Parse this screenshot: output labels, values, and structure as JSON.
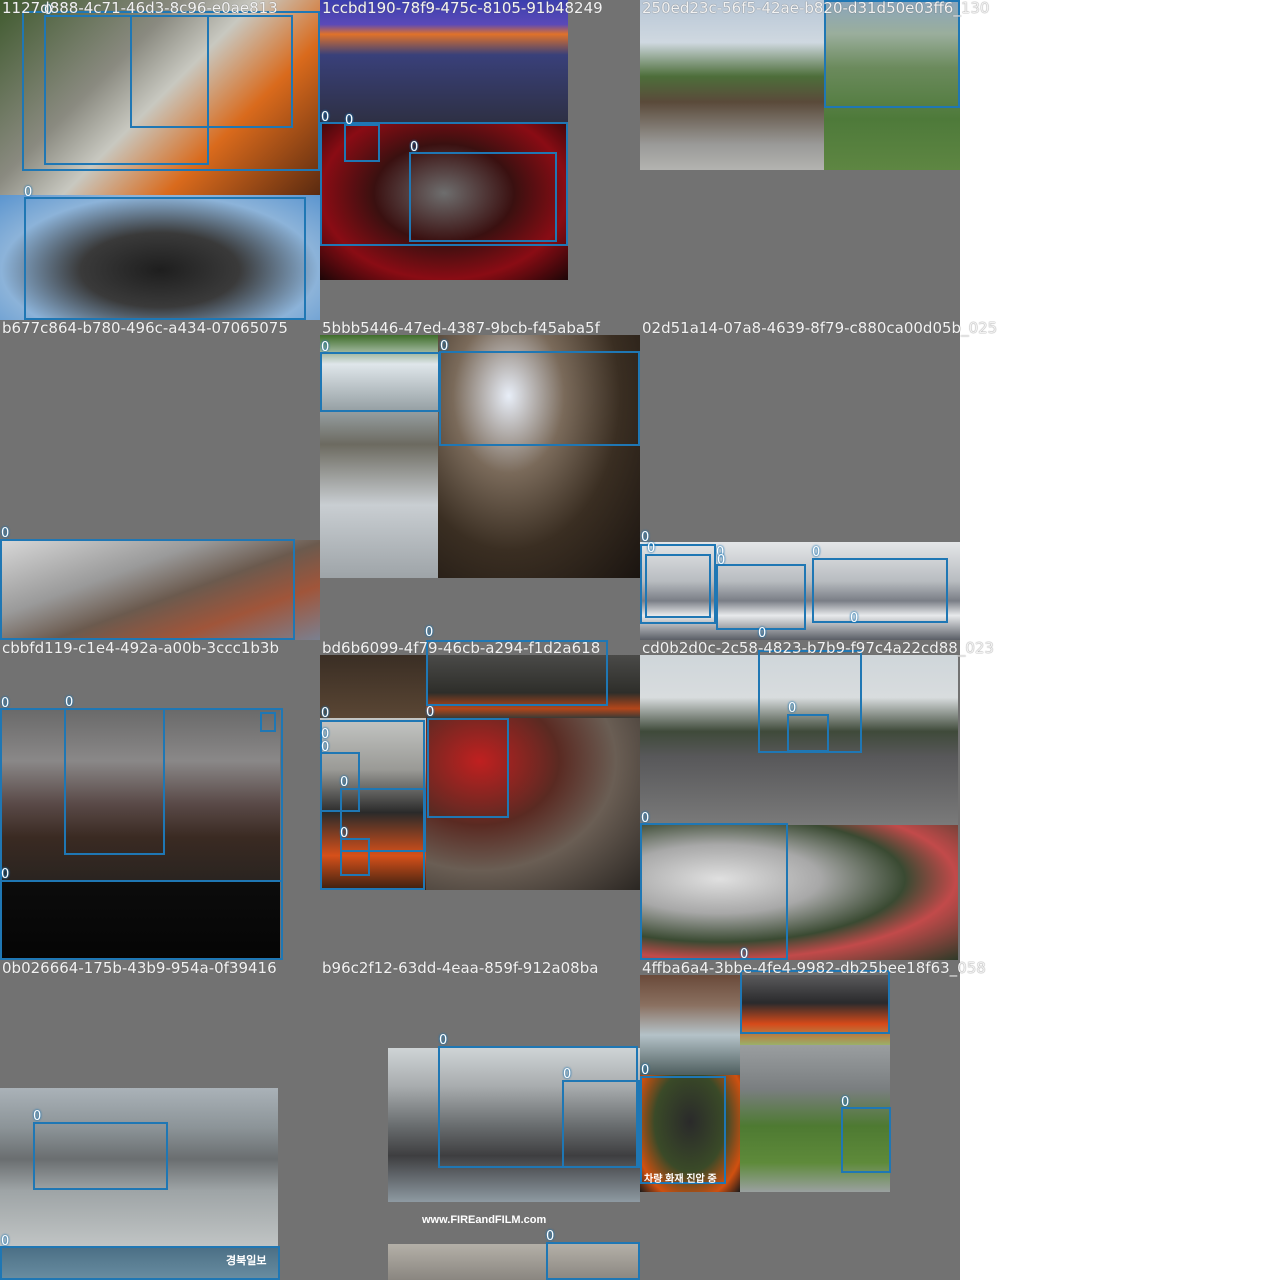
{
  "grid": {
    "background": "#727272",
    "box_color": "#1f77b4",
    "class_label": "0"
  },
  "cells": [
    {
      "filename": "1127d888-4c71-46d3-8c96-e0ae813"
    },
    {
      "filename": "1ccbd190-78f9-475c-8105-91b48249"
    },
    {
      "filename": "250ed23c-56f5-42ae-b820-d31d50e03ff6_130"
    },
    {
      "filename": "b677c864-b780-496c-a434-07065075"
    },
    {
      "filename": "5bbb5446-47ed-4387-9bcb-f45aba5f"
    },
    {
      "filename": "02d51a14-07a8-4639-8f79-c880ca00d05b_025"
    },
    {
      "filename": "cbbfd119-c1e4-492a-a00b-3ccc1b3b"
    },
    {
      "filename": "bd6b6099-4f79-46cb-a294-f1d2a618"
    },
    {
      "filename": "cd0b2d0c-2c58-4823-b7b9-f97c4a22cd88_023"
    },
    {
      "filename": "0b026664-175b-43b9-954a-0f39416"
    },
    {
      "filename": "b96c2f12-63dd-4eaa-859f-912a08ba"
    },
    {
      "filename": "4ffba6a4-3bbe-4fe4-9982-db25bee18f63_058"
    }
  ],
  "watermarks": {
    "fireandfilm": "www.FIREandFILM.com",
    "korean_news": "경북일보",
    "korean_caption": "차량 화재 진압 중"
  }
}
